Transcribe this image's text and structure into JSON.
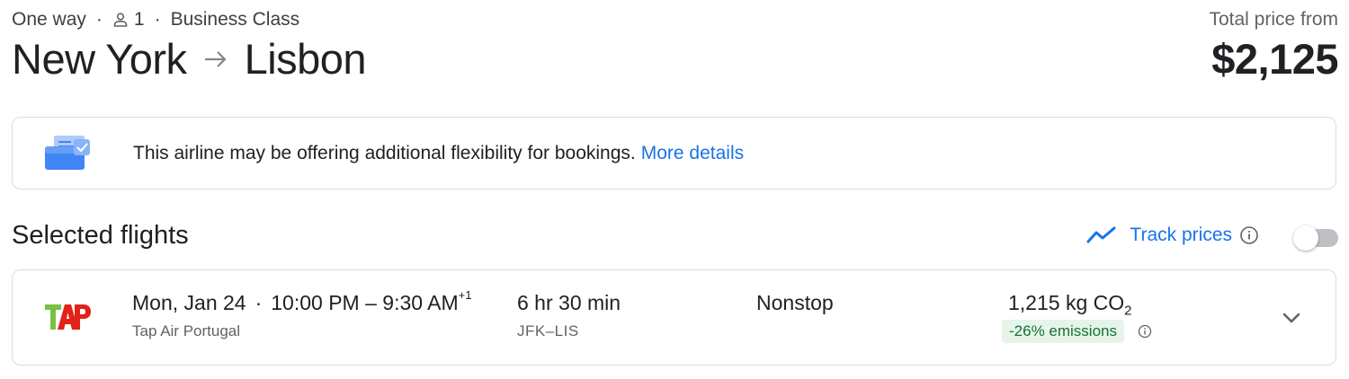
{
  "header": {
    "trip_type": "One way",
    "passengers": "1",
    "cabin": "Business Class",
    "origin": "New York",
    "destination": "Lisbon",
    "price_label": "Total price from",
    "price": "$2,125"
  },
  "notice": {
    "text": "This airline may be offering additional flexibility for bookings.",
    "link": "More details",
    "icon": "document-check-icon"
  },
  "selected": {
    "title": "Selected flights",
    "track_label": "Track prices",
    "track_icon": "trending-icon",
    "track_enabled": false
  },
  "flight": {
    "date": "Mon, Jan 24",
    "times": "10:00 PM – 9:30 AM",
    "day_offset": "+1",
    "airline": "Tap Air Portugal",
    "airline_logo_text": "TAP",
    "duration": "6 hr 30 min",
    "airports": "JFK–LIS",
    "stops": "Nonstop",
    "emissions_value": "1,215 kg CO",
    "emissions_sub": "2",
    "emissions_badge": "-26% emissions"
  },
  "colors": {
    "accent": "#1a73e8",
    "text": "#202124",
    "muted": "#5f6368",
    "border": "#dadce0",
    "badge_bg": "#e6f4ea",
    "badge_text": "#137333",
    "tap_green": "#7ac143",
    "tap_red": "#e2231a"
  }
}
